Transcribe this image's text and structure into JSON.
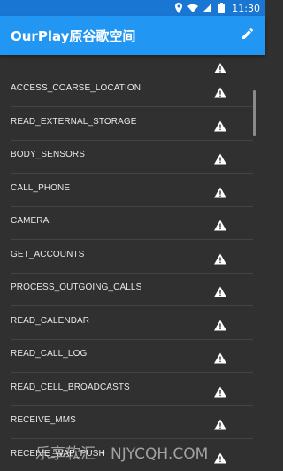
{
  "status_bar": {
    "time": "11:30",
    "icons": [
      "location-icon",
      "wifi-icon",
      "signal-icon",
      "battery-icon"
    ]
  },
  "app_bar": {
    "title": "OurPlay原谷歌空间",
    "action_icon": "edit-pencil-icon"
  },
  "permissions": [
    {
      "label": "ACCESS_COARSE_LOCATION",
      "icon": "warning-icon"
    },
    {
      "label": "READ_EXTERNAL_STORAGE",
      "icon": "warning-icon"
    },
    {
      "label": "BODY_SENSORS",
      "icon": "warning-icon"
    },
    {
      "label": "CALL_PHONE",
      "icon": "warning-icon"
    },
    {
      "label": "CAMERA",
      "icon": "warning-icon"
    },
    {
      "label": "GET_ACCOUNTS",
      "icon": "warning-icon"
    },
    {
      "label": "PROCESS_OUTGOING_CALLS",
      "icon": "warning-icon"
    },
    {
      "label": "READ_CALENDAR",
      "icon": "warning-icon"
    },
    {
      "label": "READ_CALL_LOG",
      "icon": "warning-icon"
    },
    {
      "label": "READ_CELL_BROADCASTS",
      "icon": "warning-icon"
    },
    {
      "label": "RECEIVE_MMS",
      "icon": "warning-icon"
    },
    {
      "label": "RECEIVE_WAP_PUSH",
      "icon": "warning-icon"
    }
  ],
  "watermark": "乐享软汇・NJYCQH.COM",
  "colors": {
    "status_bar": "#1976d2",
    "app_bar": "#2196f3",
    "background": "#303030",
    "divider": "#444444"
  }
}
